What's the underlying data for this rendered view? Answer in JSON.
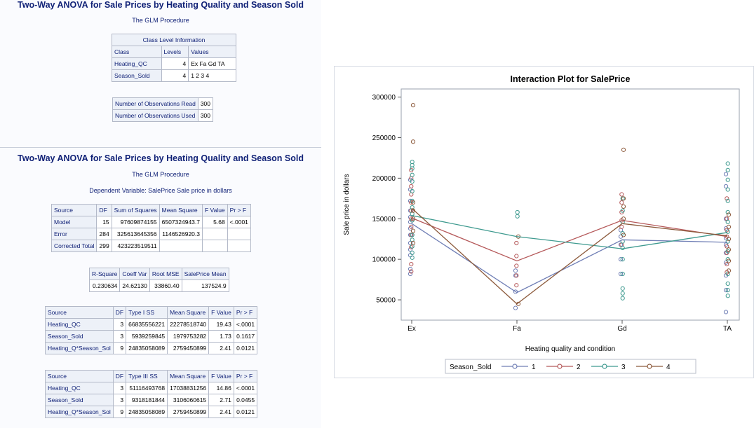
{
  "section1": {
    "title": "Two-Way ANOVA for Sale Prices by Heating Quality and Season Sold",
    "procedure": "The GLM Procedure",
    "class_level": {
      "caption": "Class Level Information",
      "headers": [
        "Class",
        "Levels",
        "Values"
      ],
      "rows": [
        [
          "Heating_QC",
          "4",
          "Ex Fa Gd TA"
        ],
        [
          "Season_Sold",
          "4",
          "1 2 3 4"
        ]
      ]
    },
    "observations": {
      "rows": [
        [
          "Number of Observations Read",
          "300"
        ],
        [
          "Number of Observations Used",
          "300"
        ]
      ]
    }
  },
  "section2": {
    "title": "Two-Way ANOVA for Sale Prices by Heating Quality and Season Sold",
    "procedure": "The GLM Procedure",
    "dependent": "Dependent Variable: SalePrice Sale price in dollars",
    "anova": {
      "headers": [
        "Source",
        "DF",
        "Sum of Squares",
        "Mean Square",
        "F Value",
        "Pr > F"
      ],
      "rows": [
        [
          "Model",
          "15",
          "97609874155",
          "6507324943.7",
          "5.68",
          "<.0001"
        ],
        [
          "Error",
          "284",
          "325613645356",
          "1146526920.3",
          "",
          ""
        ],
        [
          "Corrected Total",
          "299",
          "423223519511",
          "",
          "",
          ""
        ]
      ]
    },
    "fit": {
      "headers": [
        "R-Square",
        "Coeff Var",
        "Root MSE",
        "SalePrice Mean"
      ],
      "row": [
        "0.230634",
        "24.62130",
        "33860.40",
        "137524.9"
      ]
    },
    "type1": {
      "headers": [
        "Source",
        "DF",
        "Type I SS",
        "Mean Square",
        "F Value",
        "Pr > F"
      ],
      "rows": [
        [
          "Heating_QC",
          "3",
          "66835556221",
          "22278518740",
          "19.43",
          "<.0001"
        ],
        [
          "Season_Sold",
          "3",
          "5939259845",
          "1979753282",
          "1.73",
          "0.1617"
        ],
        [
          "Heating_Q*Season_Sol",
          "9",
          "24835058089",
          "2759450899",
          "2.41",
          "0.0121"
        ]
      ]
    },
    "type3": {
      "headers": [
        "Source",
        "DF",
        "Type III SS",
        "Mean Square",
        "F Value",
        "Pr > F"
      ],
      "rows": [
        [
          "Heating_QC",
          "3",
          "51116493768",
          "17038831256",
          "14.86",
          "<.0001"
        ],
        [
          "Season_Sold",
          "3",
          "9318181844",
          "3106060615",
          "2.71",
          "0.0455"
        ],
        [
          "Heating_Q*Season_Sol",
          "9",
          "24835058089",
          "2759450899",
          "2.41",
          "0.0121"
        ]
      ]
    }
  },
  "chart_data": {
    "type": "scatter",
    "title": "Interaction Plot for SalePrice",
    "xlabel": "Heating quality and condition",
    "ylabel": "Sale price in dollars",
    "categories": [
      "Ex",
      "Fa",
      "Gd",
      "TA"
    ],
    "ylim": [
      25000,
      310000
    ],
    "yticks": [
      50000,
      100000,
      150000,
      200000,
      250000,
      300000
    ],
    "ytick_labels": [
      "50000",
      "100000",
      "150000",
      "200000",
      "250000",
      "300000"
    ],
    "legend_title": "Season_Sold",
    "legend_position": "bottom",
    "series": [
      {
        "name": "1",
        "color": "#6f7eb5",
        "means": [
          144000,
          59000,
          124000,
          121000
        ],
        "points": [
          [
            82000,
            88000,
            105000,
            112000,
            120000,
            130000,
            138000,
            146000,
            152000,
            160000,
            172000,
            186000,
            198000
          ],
          [
            40000,
            60000,
            80000,
            86000
          ],
          [
            82000,
            100000,
            118000,
            128000,
            136000
          ],
          [
            35000,
            62000,
            80000,
            96000,
            108000,
            118000,
            126000,
            138000,
            150000,
            190000,
            205000
          ]
        ]
      },
      {
        "name": "2",
        "color": "#b5595a",
        "means": [
          151000,
          98000,
          148000,
          128000
        ],
        "points": [
          [
            85000,
            94000,
            115000,
            130000,
            140000,
            150000,
            160000,
            170000,
            180000,
            190000,
            200000,
            210000
          ],
          [
            68000,
            80000,
            92000,
            104000,
            120000
          ],
          [
            118000,
            140000,
            148000,
            158000,
            170000,
            180000
          ],
          [
            84000,
            94000,
            108000,
            116000,
            128000,
            136000,
            150000,
            175000
          ]
        ]
      },
      {
        "name": "3",
        "color": "#3e9a8f",
        "means": [
          154000,
          128000,
          113000,
          133000
        ],
        "points": [
          [
            102000,
            108000,
            116000,
            124000,
            130000,
            148000,
            156000,
            164000,
            172000,
            184000,
            196000,
            204000,
            212000,
            216000,
            220000
          ],
          [
            153000,
            158000
          ],
          [
            52000,
            58000,
            64000,
            82000,
            100000,
            114000,
            122000,
            132000,
            146000,
            160000,
            175000
          ],
          [
            55000,
            62000,
            70000,
            82000,
            100000,
            110000,
            122000,
            134000,
            146000,
            158000,
            172000,
            186000,
            198000,
            210000,
            218000
          ]
        ]
      },
      {
        "name": "4",
        "color": "#8c5a3c",
        "means": [
          163000,
          45000,
          144000,
          129000
        ],
        "points": [
          [
            245000,
            290000,
            120000,
            135000,
            150000,
            160000,
            170000
          ],
          [
            45000,
            128000
          ],
          [
            235000,
            130000,
            150000,
            165000,
            175000
          ],
          [
            86000,
            98000,
            112000,
            125000,
            140000,
            155000
          ]
        ]
      }
    ]
  }
}
